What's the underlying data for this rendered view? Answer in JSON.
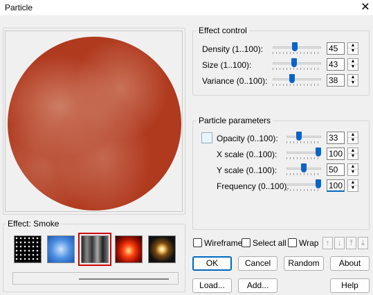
{
  "window": {
    "title": "Particle"
  },
  "effect": {
    "label": "Effect: Smoke",
    "thumbnails": [
      {
        "name": "stars"
      },
      {
        "name": "sky"
      },
      {
        "name": "smoke",
        "selected": true
      },
      {
        "name": "fire"
      },
      {
        "name": "starburst"
      }
    ]
  },
  "effect_control": {
    "title": "Effect control",
    "density": {
      "label": "Density (1..100):",
      "value": "45",
      "level": 45
    },
    "size": {
      "label": "Size (1..100):",
      "value": "43",
      "level": 43
    },
    "variance": {
      "label": "Variance (0..100):",
      "value": "38",
      "level": 38
    }
  },
  "particle_parameters": {
    "title": "Particle parameters",
    "color": "#e6f7ff",
    "opacity": {
      "label": "Opacity (0..100):",
      "value": "33",
      "level": 33
    },
    "x_scale": {
      "label": "X scale (0..100):",
      "value": "100",
      "level": 100
    },
    "y_scale": {
      "label": "Y scale (0..100):",
      "value": "50",
      "level": 50
    },
    "frequency": {
      "label": "Frequency (0..100):",
      "value": "100",
      "level": 100
    }
  },
  "options": {
    "wireframe": "Wireframe",
    "select_all": "Select all",
    "wrap": "Wrap"
  },
  "buttons": {
    "ok": "OK",
    "cancel": "Cancel",
    "random": "Random",
    "about": "About",
    "load": "Load...",
    "add": "Add...",
    "help": "Help"
  }
}
